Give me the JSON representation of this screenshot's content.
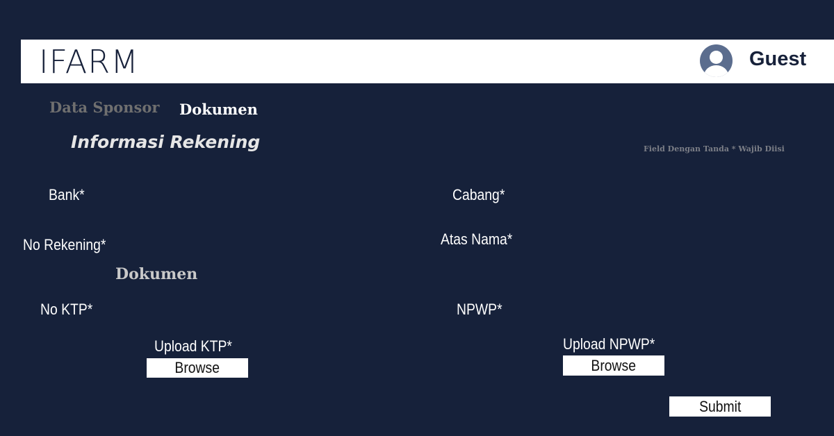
{
  "header": {
    "logo": "IFARM",
    "user_name": "Guest"
  },
  "tabs": [
    {
      "label": "Data Sponsor",
      "active": false
    },
    {
      "label": "Dokumen",
      "active": true
    }
  ],
  "section_title": "Informasi Rekening",
  "required_hint": "Field Dengan Tanda * Wajib Diisi",
  "fields": {
    "bank": "Bank*",
    "cabang": "Cabang*",
    "no_rekening": "No Rekening*",
    "atas_nama": "Atas Nama*",
    "no_ktp": "No KTP*",
    "npwp": "NPWP*",
    "upload_ktp": "Upload KTP*",
    "upload_npwp": "Upload NPWP*"
  },
  "section2_title": "Dokumen",
  "buttons": {
    "browse_ktp": "Browse",
    "browse_npwp": "Browse",
    "submit": "Submit"
  },
  "colors": {
    "background": "#16213a",
    "header": "#ffffff",
    "avatar": "#5b6d8e"
  }
}
